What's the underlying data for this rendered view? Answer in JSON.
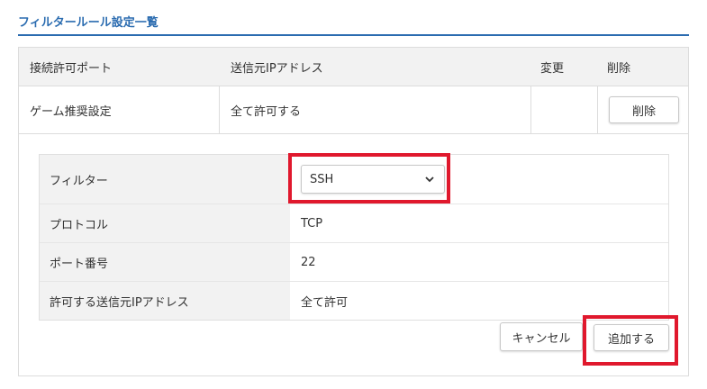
{
  "page": {
    "title": "フィルタールール設定一覧"
  },
  "table": {
    "headers": [
      "接続許可ポート",
      "送信元IPアドレス",
      "変更",
      "削除"
    ],
    "row": {
      "port": "ゲーム推奨設定",
      "source_ip": "全て許可する",
      "change": "",
      "delete_label": "削除"
    }
  },
  "form": {
    "filter": {
      "label": "フィルター",
      "selected": "SSH"
    },
    "protocol": {
      "label": "プロトコル",
      "value": "TCP"
    },
    "port": {
      "label": "ポート番号",
      "value": "22"
    },
    "source": {
      "label": "許可する送信元IPアドレス",
      "value": "全て許可"
    },
    "cancel_label": "キャンセル",
    "add_label": "追加する"
  },
  "colors": {
    "accent": "#2b6cb0",
    "highlight": "#e0182d",
    "header_bg": "#f2f2f2"
  }
}
